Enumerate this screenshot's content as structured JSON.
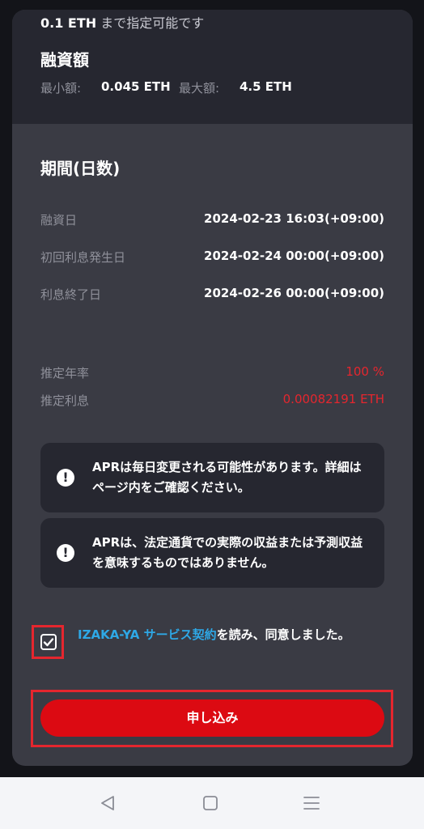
{
  "header": {
    "hint_amount": "0.1 ETH",
    "hint_suffix": " まで指定可能です"
  },
  "loan_amount": {
    "title": "融資額",
    "min_label": "最小額:",
    "min_value": "0.045 ETH",
    "max_label": "最大額:",
    "max_value": "4.5 ETH"
  },
  "period": {
    "title": "期間(日数)",
    "rows": [
      {
        "label": "融資日",
        "value": "2024-02-23 16:03(+09:00)"
      },
      {
        "label": "初回利息発生日",
        "value": "2024-02-24 00:00(+09:00)"
      },
      {
        "label": "利息終了日",
        "value": "2024-02-26 00:00(+09:00)"
      }
    ]
  },
  "estimate": {
    "apr_label": "推定年率",
    "apr_value": "100 %",
    "interest_label": "推定利息",
    "interest_value": "0.00082191 ETH"
  },
  "notices": [
    {
      "icon": "exclamation-circle-icon",
      "text": "APRは毎日変更される可能性があります。詳細はページ内をご確認ください。"
    },
    {
      "icon": "exclamation-circle-icon",
      "text": "APRは、法定通貨での実際の収益または予測収益を意味するものではありません。"
    }
  ],
  "agreement": {
    "checked": true,
    "link_text": "IZAKA-YA サービス契約",
    "suffix_text": "を読み、同意しました。"
  },
  "apply_button": {
    "label": "申し込み"
  },
  "colors": {
    "accent_red": "#dc0a12",
    "highlight_red": "#e5262e",
    "link_blue": "#2ea8e6",
    "card_bg": "#3a3b44",
    "panel_bg": "#262730"
  },
  "navbar": {
    "back_icon": "triangle-back-icon",
    "home_icon": "square-home-icon",
    "menu_icon": "menu-lines-icon"
  }
}
